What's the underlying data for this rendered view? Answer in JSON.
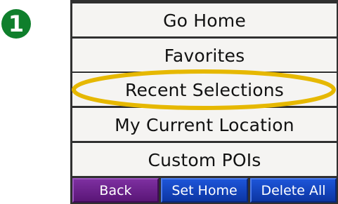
{
  "step_badge": "❶",
  "menu": {
    "items": [
      {
        "label": "Go Home"
      },
      {
        "label": "Favorites"
      },
      {
        "label": "Recent Selections",
        "highlighted": true
      },
      {
        "label": "My Current Location"
      },
      {
        "label": "Custom POIs"
      }
    ]
  },
  "bottom_bar": {
    "back_label": "Back",
    "set_home_label": "Set Home",
    "delete_all_label": "Delete All"
  },
  "colors": {
    "highlight_ring": "#e6b800",
    "step_badge": "#0f7f2c",
    "back_button": "#6a1f8c",
    "action_buttons": "#1544c0"
  }
}
